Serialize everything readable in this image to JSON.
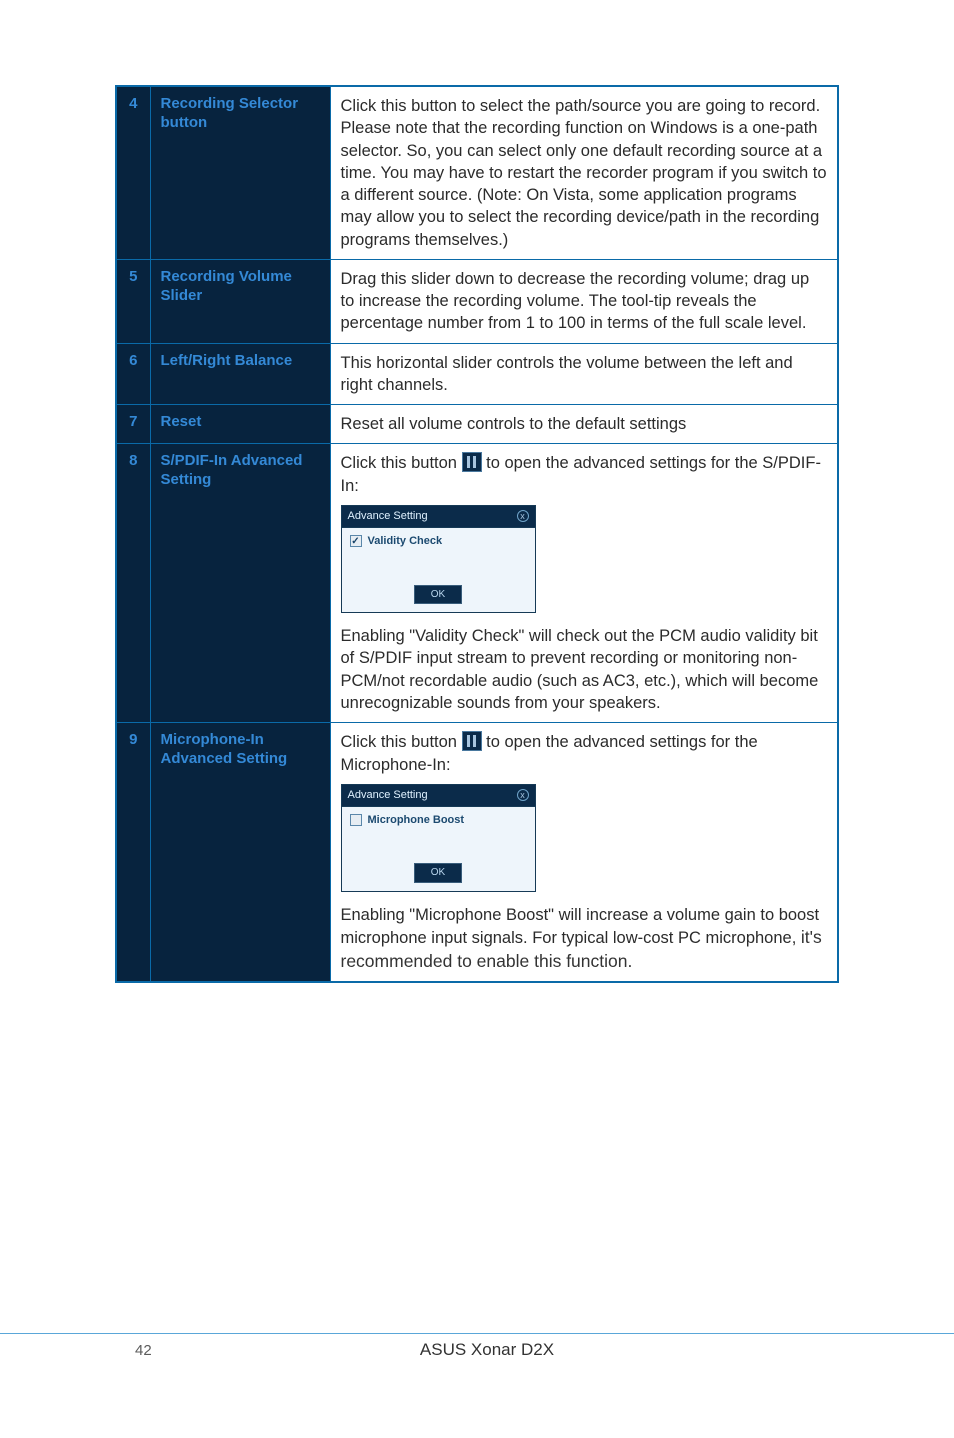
{
  "rows": [
    {
      "num": "4",
      "name": "Recording Selector button",
      "desc": "Click this button to select the path/source you are going to record. Please note that the recording function on Windows is a one-path selector. So, you can select only one default recording source at a time. You may have to restart the recorder program if you switch to a different source. (Note: On Vista, some application programs may allow you to select the recording device/path in the recording programs themselves.)"
    },
    {
      "num": "5",
      "name": "Recording Volume Slider",
      "desc": "Drag this slider down to decrease the recording volume; drag up to increase the recording volume. The tool-tip reveals the percentage number from 1 to 100 in terms of the full scale level."
    },
    {
      "num": "6",
      "name": "Left/Right Balance",
      "desc": "This horizontal slider controls the volume between the left and right channels."
    },
    {
      "num": "7",
      "name": "Reset",
      "desc": "Reset all volume controls to the default settings"
    },
    {
      "num": "8",
      "name": "S/PDIF-In Advanced Setting",
      "before": "Click this button ",
      "after1": " to open the advanced settings for the S/PDIF-In:",
      "dlg_title": "Advance Setting",
      "dlg_check_label": "Validity Check",
      "dlg_checked": true,
      "dlg_ok": "OK",
      "after2": "Enabling \"Validity Check\" will check out the PCM audio validity bit of S/PDIF input stream to prevent recording or monitoring non-PCM/not recordable audio (such as AC3, etc.), which will become unrecognizable sounds from your speakers."
    },
    {
      "num": "9",
      "name": "Microphone-In Advanced Setting",
      "before": "Click this button ",
      "after1": " to open the advanced settings for the Microphone-In:",
      "dlg_title": "Advance Setting",
      "dlg_check_label": "Microphone Boost",
      "dlg_checked": false,
      "dlg_ok": "OK",
      "after2a": "Enabling \"Microphone Boost\" will increase a volume gain to boost microphone input signals. For typical low-cost PC microphone, ",
      "after2b": "it's recommended to enable this function."
    }
  ],
  "footer": {
    "page": "42",
    "title": "ASUS Xonar D2X"
  }
}
